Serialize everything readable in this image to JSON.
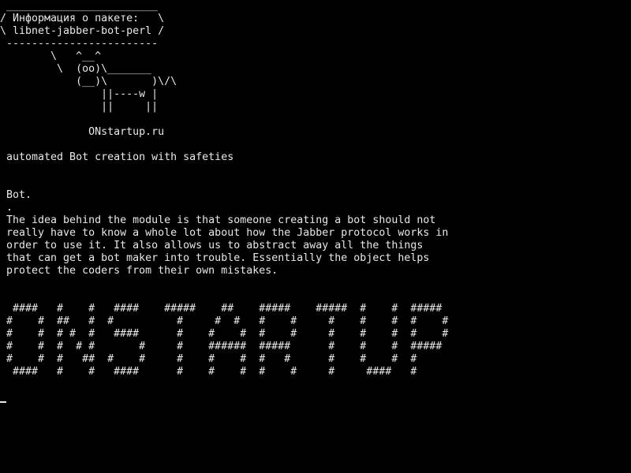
{
  "cowsay": {
    "bubble_top": " ________________________",
    "bubble_line1": "/ Информация о пакете:   \\",
    "bubble_line2": "\\ libnet-jabber-bot-perl /",
    "bubble_bottom": " ------------------------",
    "cow_line1": "        \\   ^__^",
    "cow_line2": "         \\  (oo)\\_______",
    "cow_line3": "            (__)\\       )\\/\\",
    "cow_line4": "                ||----w |",
    "cow_line5": "                ||     ||",
    "site": "              ONstartup.ru"
  },
  "summary": " automated Bot creation with safeties",
  "description": {
    "line1": " Bot.",
    "line2": " .",
    "line3": " The idea behind the module is that someone creating a bot should not",
    "line4": " really have to know a whole lot about how the Jabber protocol works in",
    "line5": " order to use it. It also allows us to abstract away all the things",
    "line6": " that can get a bot maker into trouble. Essentially the object helps",
    "line7": " protect the coders from their own mistakes."
  },
  "banner": {
    "row1": "  ####   #    #   ####    #####    ##    #####    #####  #    #  #####",
    "row2": " #    #  ##   #  #          #     #  #   #    #     #    #    #  #    #",
    "row3": " #    #  # #  #   ####      #    #    #  #    #     #    #    #  #    #",
    "row4": " #    #  #  # #       #     #    ######  #####      #    #    #  #####",
    "row5": " #    #  #   ##  #    #     #    #    #  #   #      #    #    #  #",
    "row6": "  ####   #    #   ####      #    #    #  #    #     #     ####   #"
  }
}
